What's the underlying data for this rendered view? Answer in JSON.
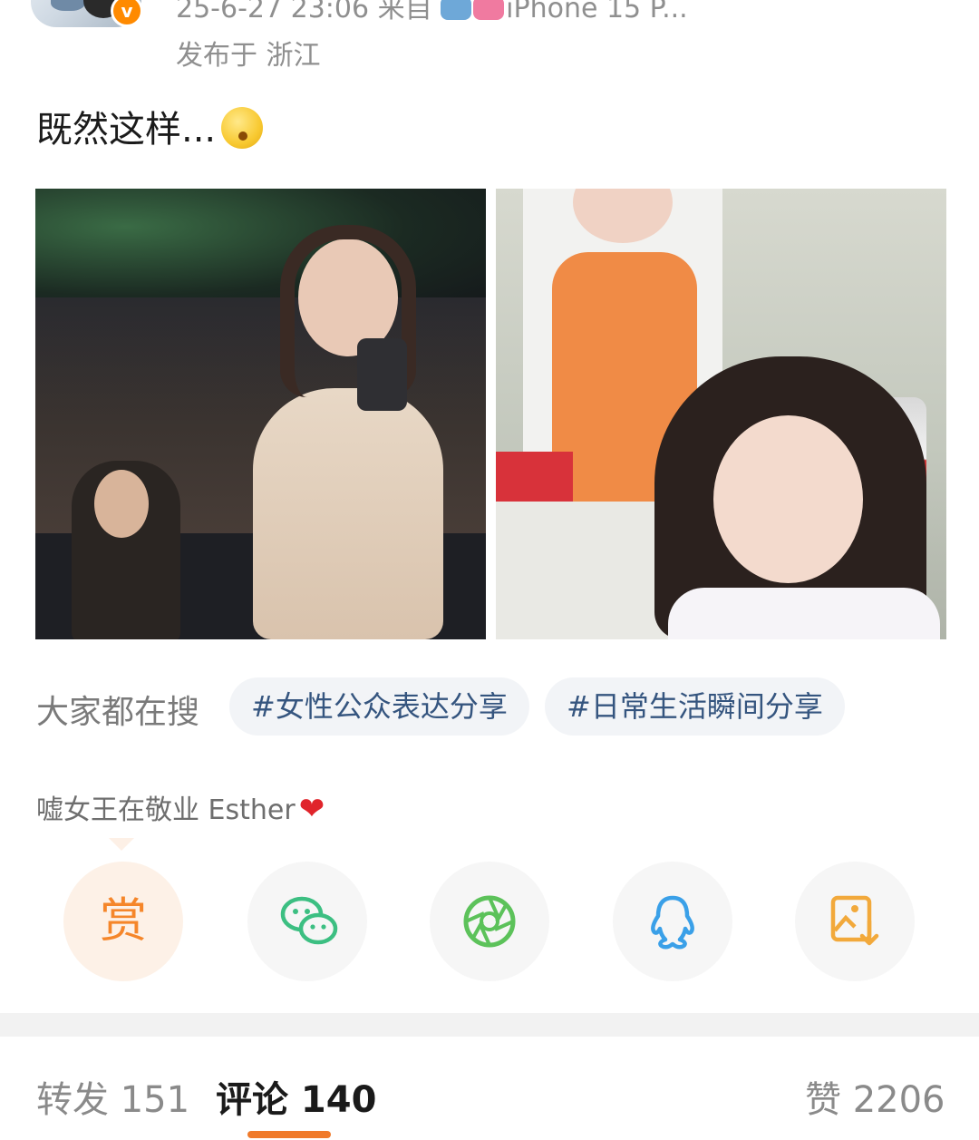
{
  "header": {
    "meta_line": "25-6-27 23:06  来自",
    "device": "iPhone 15 P...",
    "published": "发布于 浙江",
    "verified_badge": "v"
  },
  "post": {
    "text": "既然这样..."
  },
  "images": [
    "photo-1",
    "photo-2"
  ],
  "trending": {
    "label": "大家都在搜",
    "tags": [
      "#女性公众表达分享",
      "#日常生活瞬间分享"
    ]
  },
  "author_sign": {
    "text": "嘘女王在敬业 Esther",
    "heart": "❤"
  },
  "share": {
    "reward_label": "赏",
    "icons": [
      "wechat-icon",
      "moments-icon",
      "qq-icon",
      "save-image-icon"
    ],
    "colors": {
      "reward": "#f5862a",
      "wechat": "#3cbf82",
      "moments": "#5cc25a",
      "qq": "#3aa0e8",
      "save": "#f2a93b"
    }
  },
  "tabs": {
    "repost": "转发 151",
    "comments": "评论 140",
    "likes": "赞 2206",
    "active": "comments",
    "accent": "#f07a2a"
  }
}
